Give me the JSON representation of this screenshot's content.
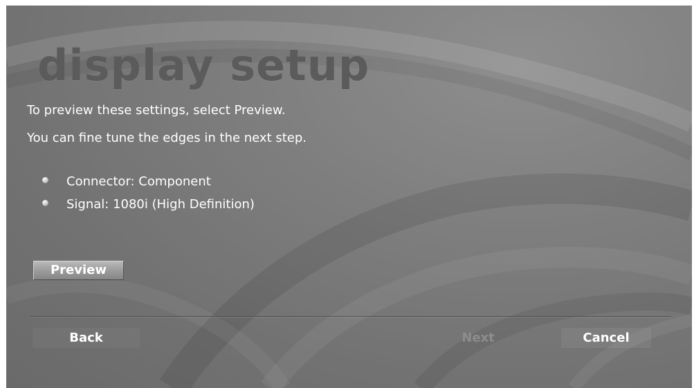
{
  "page": {
    "title": "display setup",
    "instructions": [
      "To preview these settings, select Preview.",
      "You can fine tune the edges in the next step."
    ]
  },
  "settings": [
    {
      "label": "Connector: Component"
    },
    {
      "label": "Signal: 1080i (High Definition)"
    }
  ],
  "actions": {
    "preview_label": "Preview"
  },
  "nav": {
    "back_label": "Back",
    "next_label": "Next",
    "next_enabled": false,
    "cancel_label": "Cancel"
  },
  "colors": {
    "text": "#ffffff",
    "title": "#5b5b5b",
    "disabled_text": "#8d8d8d",
    "background": "#7f7f7f"
  }
}
